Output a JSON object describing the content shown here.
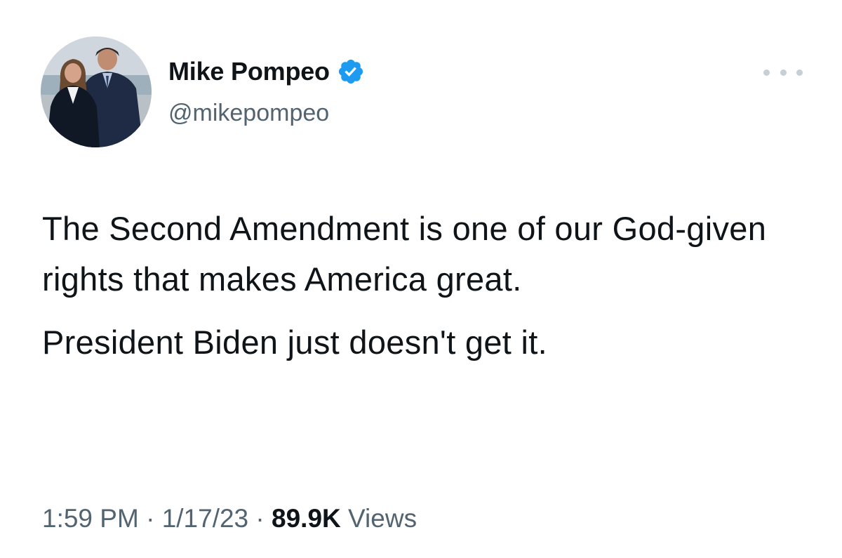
{
  "author": {
    "display_name": "Mike Pompeo",
    "handle": "@mikepompeo",
    "verified": true,
    "verified_color": "#1d9bf0"
  },
  "icons": {
    "verified": "verified-badge-icon",
    "more": "more-horizontal-icon"
  },
  "tweet": {
    "paragraphs": [
      "The Second Amendment is one of our God-given rights that makes America great.",
      "President Biden just doesn't get it."
    ],
    "time": "1:59 PM",
    "separator": "·",
    "date": "1/17/23",
    "views_count": "89.9K",
    "views_label": "Views"
  },
  "colors": {
    "text_primary": "#0f1419",
    "text_secondary": "#536471"
  }
}
